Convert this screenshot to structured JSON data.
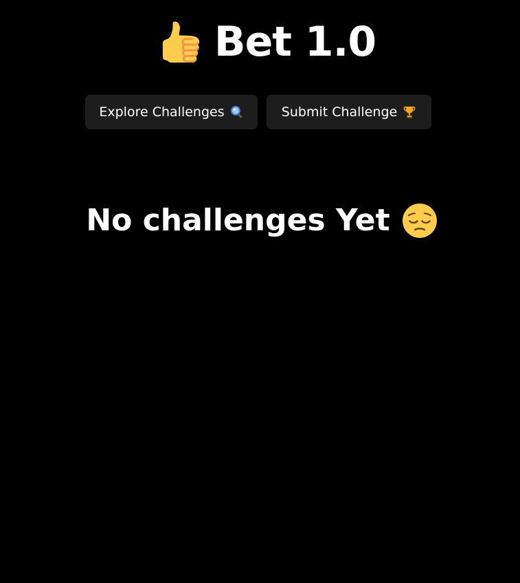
{
  "header": {
    "title": "Bet 1.0",
    "logo_icon": "thumbs-up-icon"
  },
  "nav": {
    "explore_label": "Explore Challenges",
    "explore_icon": "magnifying-glass-icon",
    "submit_label": "Submit Challenge",
    "submit_icon": "trophy-icon"
  },
  "empty_state": {
    "message": "No challenges Yet",
    "icon": "pensive-face-icon"
  },
  "colors": {
    "background": "#000000",
    "button_bg": "#1d1d1d",
    "text": "#ffffff",
    "emoji_yellow": "#ffcc4d"
  }
}
